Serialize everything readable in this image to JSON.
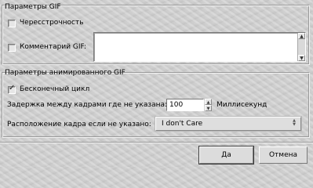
{
  "gif_section": {
    "title": "Параметры GIF",
    "interlace_label": "Чересстрочность",
    "interlace_checked": false,
    "comment_label": "Комментарий GIF:",
    "comment_checked": false,
    "comment_value": ""
  },
  "anim_section": {
    "title": "Параметры анимированного GIF",
    "loop_label": "Бесконечный цикл",
    "loop_checked": true,
    "delay_label": "Задержка между кадрами где не указана:",
    "delay_value": "100",
    "delay_unit": "Миллисекунд",
    "disposal_label": "Расположение кадра если не указано:",
    "disposal_value": "I don't Care"
  },
  "buttons": {
    "ok_label": "Да",
    "cancel_label": "Отмена"
  },
  "icons": {
    "check": "check-mark-icon",
    "up": "arrow-up-icon",
    "down": "arrow-down-icon"
  }
}
